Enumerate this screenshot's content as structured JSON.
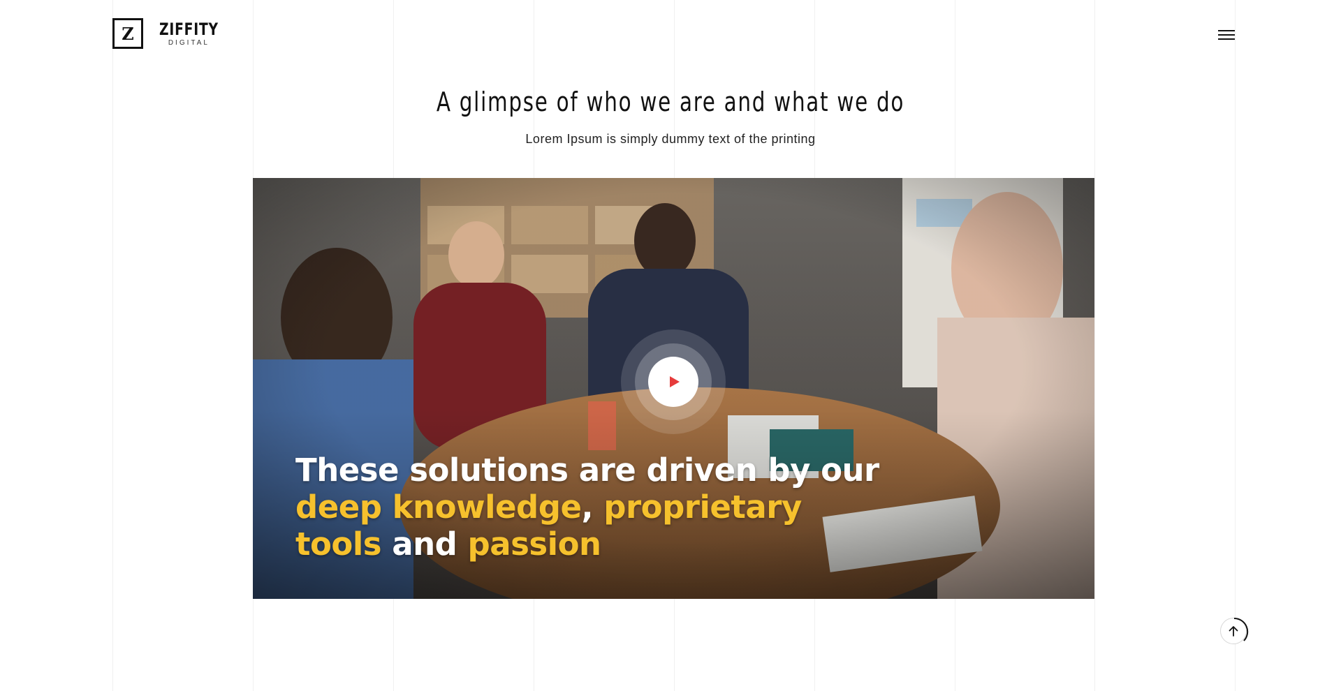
{
  "brand": {
    "mark": "Z",
    "name": "ZIFFITY",
    "tagline": "DIGITAL"
  },
  "header": {
    "menu_icon": "hamburger-icon"
  },
  "section": {
    "title": "A glimpse of who we are and what we do",
    "subtitle": "Lorem Ipsum is simply dummy text of the printing"
  },
  "video": {
    "caption_line1_white": "These solutions are driven by our",
    "caption_line2_yellow_a": "deep knowledge",
    "caption_line2_white": ", ",
    "caption_line2_yellow_b": "proprietary",
    "caption_line3_yellow_a": "tools",
    "caption_line3_white": " and ",
    "caption_line3_yellow_b": "passion",
    "play_icon": "play-icon",
    "caption_color": "#ffffff",
    "highlight_color": "#f6c12d",
    "play_color": "#e63b3b"
  },
  "scroll_top": {
    "icon": "arrow-up-icon"
  }
}
